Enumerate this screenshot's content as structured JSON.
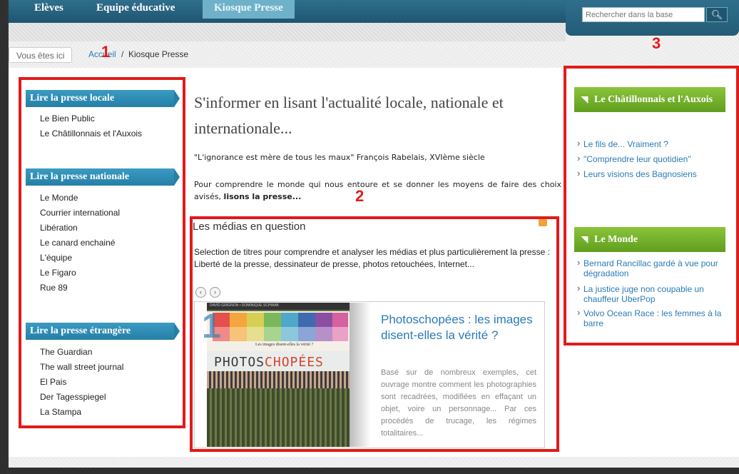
{
  "nav": {
    "items": [
      {
        "label": "Elèves"
      },
      {
        "label": "Equipe éducative"
      },
      {
        "label": "Kiosque Presse",
        "active": true
      }
    ]
  },
  "search": {
    "placeholder": "Rechercher dans la base",
    "icon": "search-icon"
  },
  "breadcrumb": {
    "here": "Vous êtes ici",
    "home": "Accueil",
    "separator": "/",
    "current": "Kiosque Presse"
  },
  "annotations": {
    "one": "1",
    "two": "2",
    "three": "3",
    "color": "#e21a1a"
  },
  "sidebar": {
    "sections": [
      {
        "title": "Lire la presse locale",
        "links": [
          "Le Bien Public",
          "Le Châtillonnais et l'Auxois"
        ]
      },
      {
        "title": "Lire la presse nationale",
        "links": [
          "Le Monde",
          "Courrier international",
          "Libération",
          "Le canard enchainé",
          "L'équipe",
          "Le Figaro",
          "Rue 89"
        ]
      },
      {
        "title": "Lire la presse étrangère",
        "links": [
          "The Guardian",
          "The wall street journal",
          "El Pais",
          "Der Tagesspiegel",
          "La Stampa"
        ]
      }
    ]
  },
  "main": {
    "title": "S'informer en lisant l'actualité locale, nationale et internationale...",
    "quote": "\"L'ignorance est mère de tous les maux\" François Rabelais, XVIème siècle",
    "intro_text": "Pour comprendre le monde qui nous entoure et se donner les moyens de faire des choix avisés,",
    "intro_bold": "lisons la presse..."
  },
  "medias": {
    "title": "Les médias en question",
    "description": "Selection de titres pour comprendre et analyser les médias et plus particulièrement la presse : Liberté de la presse, dessinateur de presse, photos retouchées, Internet...",
    "prev": "‹",
    "next": "›",
    "slide": {
      "number": "1",
      "book_top": "DAVID GRIGNON • DOMINIQUE SCHWAB",
      "book_subtitle": "Les images disent-elles la vérité ?",
      "book_title_a": "PHOTOS",
      "book_title_b": "CHOPÉES",
      "heading": "Photoschopées : les images disent-elles la vérité ?",
      "text": "Basé sur de nombreux exemples, cet ouvrage montre comment les photographies sont recadrées, modifiées en effaçant un objet, voire un personnage... Par ces procédés de trucage, les régimes totalitaires..."
    }
  },
  "widgets": [
    {
      "title": "Le Châtillonnais et l'Auxois",
      "icon": "rss-icon",
      "links": [
        "Le fils de... Vraiment ?",
        "\"Comprendre leur quotidien\"",
        "Leurs visions des Bagnosiens"
      ]
    },
    {
      "title": "Le Monde",
      "icon": "rss-icon",
      "links": [
        "Bernard Rancillac gardé à vue pour dégradation",
        "La justice juge non coupable un chauffeur UberPop",
        "Volvo Ocean Race : les femmes à la barre"
      ]
    }
  ]
}
